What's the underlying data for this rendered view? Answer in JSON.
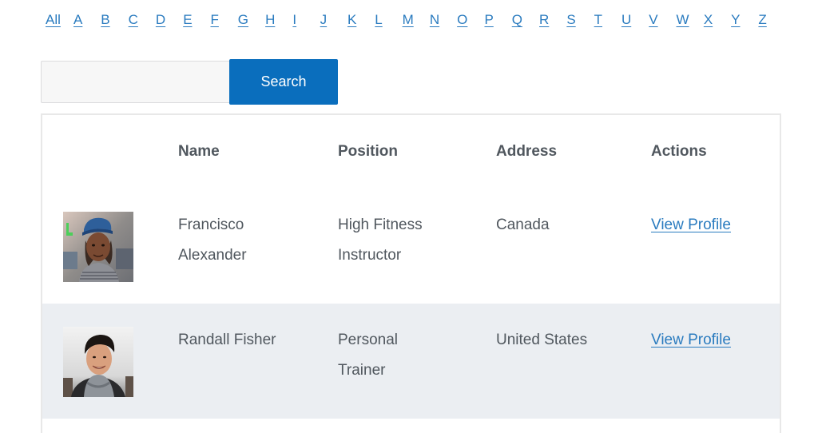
{
  "alphabet_nav": {
    "items": [
      "All",
      "A",
      "B",
      "C",
      "D",
      "E",
      "F",
      "G",
      "H",
      "I",
      "J",
      "K",
      "L",
      "M",
      "N",
      "O",
      "P",
      "Q",
      "R",
      "S",
      "T",
      "U",
      "V",
      "W",
      "X",
      "Y",
      "Z"
    ]
  },
  "search": {
    "input_value": "",
    "placeholder": "",
    "button_label": "Search"
  },
  "table": {
    "headers": {
      "photo": "",
      "name": "Name",
      "position": "Position",
      "address": "Address",
      "actions": "Actions"
    },
    "rows": [
      {
        "avatar": "person-photo-francisco",
        "name_line1": "Francisco",
        "name_line2": "Alexander",
        "position_line1": "High Fitness",
        "position_line2": "Instructor",
        "address": "Canada",
        "action_label": "View Profile"
      },
      {
        "avatar": "person-photo-randall",
        "name_line1": "Randall Fisher",
        "name_line2": "",
        "position_line1": "Personal",
        "position_line2": "Trainer",
        "address": "United States",
        "action_label": "View Profile"
      }
    ]
  },
  "colors": {
    "link": "#2a7bbf",
    "button_bg": "#0a6ebd",
    "text": "#50575e",
    "alt_row_bg": "#ebeef2",
    "border": "#e8e8e8"
  }
}
